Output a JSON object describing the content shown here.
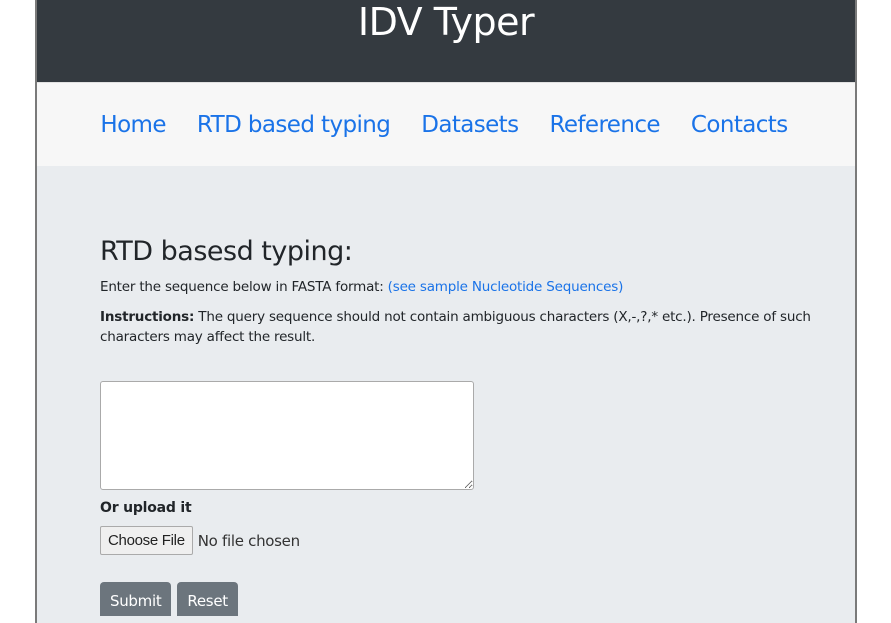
{
  "header": {
    "title": "IDV Typer"
  },
  "nav": {
    "items": [
      {
        "label": "Home"
      },
      {
        "label": "RTD based typing"
      },
      {
        "label": "Datasets"
      },
      {
        "label": "Reference"
      },
      {
        "label": "Contacts"
      }
    ]
  },
  "main": {
    "heading": "RTD basesd typing:",
    "intro_text": "Enter the sequence below in FASTA format: ",
    "sample_link": "(see sample Nucleotide Sequences)",
    "instructions_label": "Instructions:",
    "instructions_text": " The query sequence should not contain ambiguous characters (X,-,?,* etc.). Presence of such characters may affect the result.",
    "sequence_input": {
      "value": "",
      "placeholder": ""
    },
    "upload_label": "Or upload it",
    "file_button": "Choose File",
    "file_status": "No file chosen",
    "submit_label": "Submit",
    "reset_label": "Reset"
  },
  "colors": {
    "header_bg": "#343a40",
    "nav_bg": "#f7f7f7",
    "body_bg": "#e9ecef",
    "link": "#1a73e8",
    "button_bg": "#6c757d"
  }
}
